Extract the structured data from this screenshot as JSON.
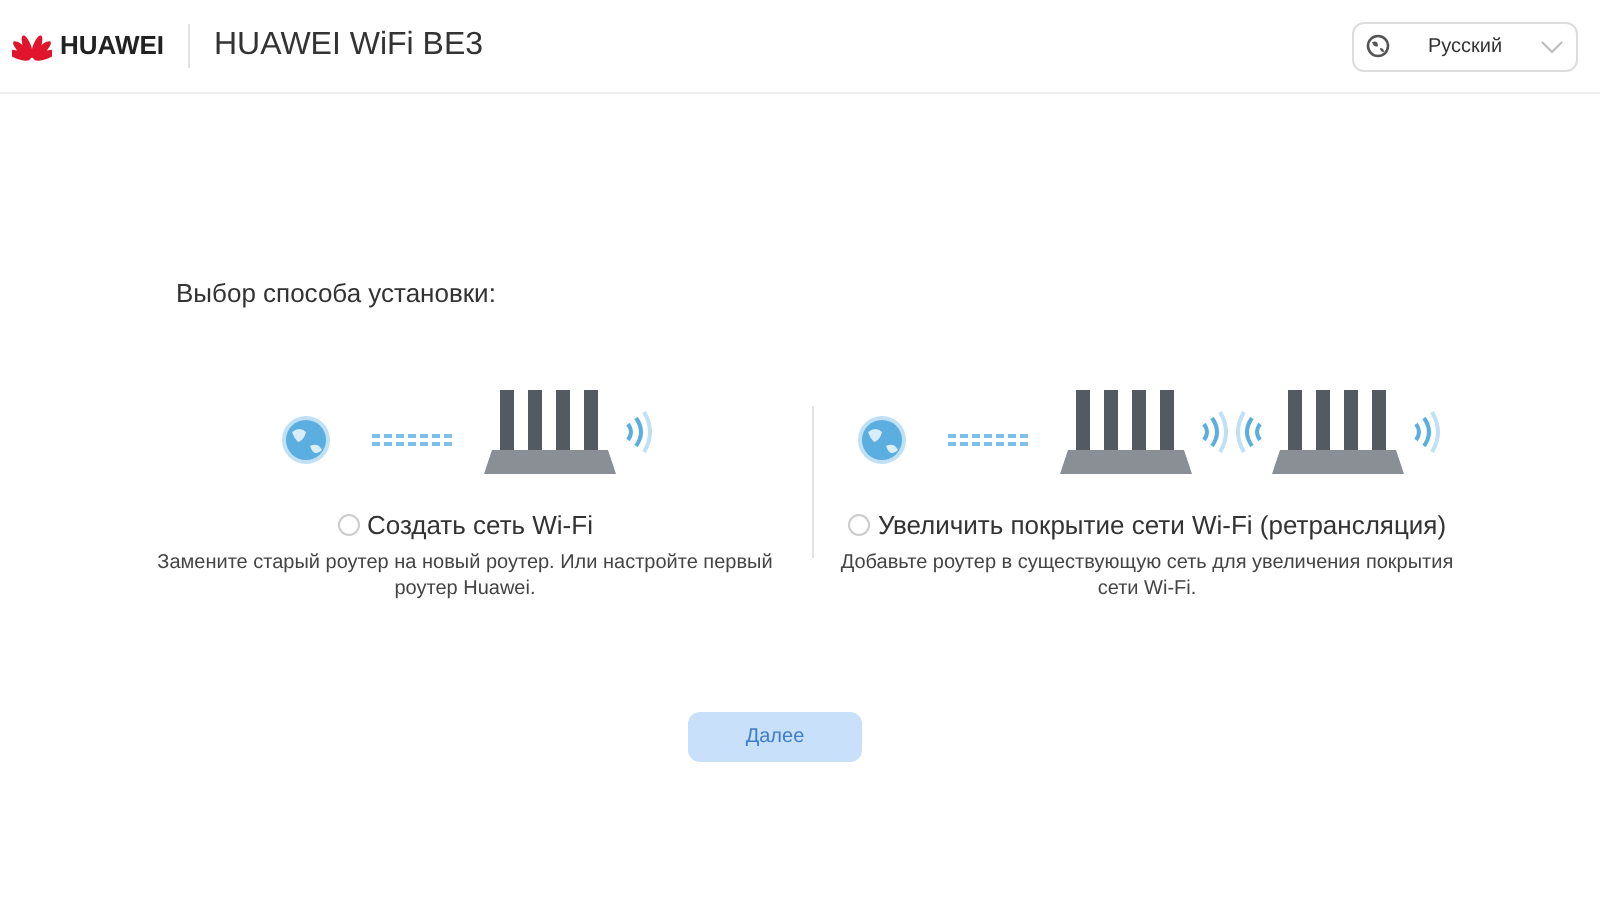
{
  "header": {
    "brand": "HUAWEI",
    "title": "HUAWEI WiFi BE3",
    "language": "Русский"
  },
  "heading": "Выбор способа установки:",
  "options": [
    {
      "kind": "single",
      "label": "Создать сеть Wi-Fi",
      "description": "Замените старый роутер на новый роутер. Или настройте первый роутер Huawei.",
      "selected": false
    },
    {
      "kind": "repeater",
      "label": "Увеличить покрытие сети Wi-Fi (ретрансляция)",
      "description": "Добавьте роутер в существующую сеть для увеличения покрытия сети Wi-Fi.",
      "selected": false
    }
  ],
  "next_button": {
    "label": "Далее",
    "disabled": true
  }
}
